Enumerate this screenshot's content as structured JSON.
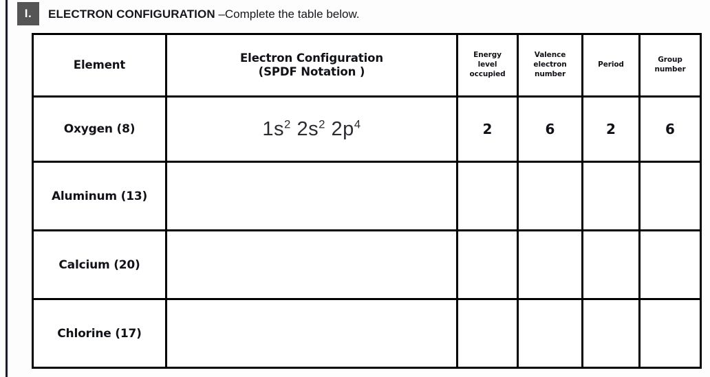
{
  "page": {
    "numeral": "I.",
    "title_bold": "ELECTRON CONFIGURATION",
    "title_rest": " –Complete the table below."
  },
  "table": {
    "headers": {
      "element": "Element",
      "configuration_line1": "Electron Configuration",
      "configuration_line2": "(SPDF Notation )",
      "energy_line1": "Energy",
      "energy_line2": "level",
      "energy_line3": "occupied",
      "valence_line1": "Valence",
      "valence_line2": "electron",
      "valence_line3": "number",
      "period": "Period",
      "group_line1": "Group",
      "group_line2": "number"
    },
    "rows": [
      {
        "element": "Oxygen (8)",
        "config_html": "1s² 2s² 2p⁴",
        "config_parts": [
          {
            "base": "1s",
            "sup": "2"
          },
          {
            "base": "2s",
            "sup": "2"
          },
          {
            "base": "2p",
            "sup": "4"
          }
        ],
        "energy_level": "2",
        "valence_electrons": "6",
        "period": "2",
        "group": "6"
      },
      {
        "element": "Aluminum (13)",
        "config_html": "",
        "config_parts": [],
        "energy_level": "",
        "valence_electrons": "",
        "period": "",
        "group": ""
      },
      {
        "element": "Calcium (20)",
        "config_html": "",
        "config_parts": [],
        "energy_level": "",
        "valence_electrons": "",
        "period": "",
        "group": ""
      },
      {
        "element": "Chlorine (17)",
        "config_html": "",
        "config_parts": [],
        "energy_level": "",
        "valence_electrons": "",
        "period": "",
        "group": ""
      }
    ]
  },
  "colors": {
    "numeral_box_bg": "#555555",
    "border": "#000000",
    "text": "#101217",
    "page_rule": "#1b1e26",
    "cell_bg": "#ffffff"
  }
}
